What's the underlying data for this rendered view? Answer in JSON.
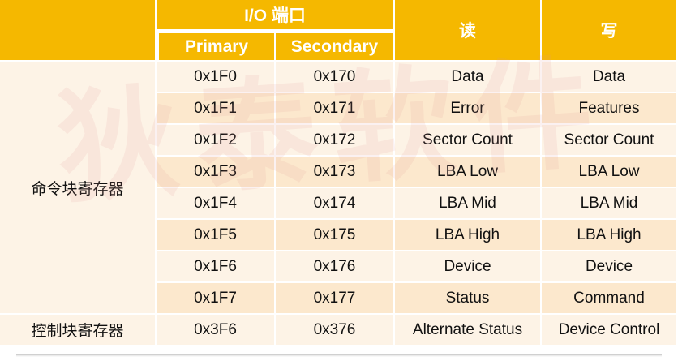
{
  "header": {
    "io_port": "I/O 端口",
    "primary": "Primary",
    "secondary": "Secondary",
    "read": "读",
    "write": "写"
  },
  "groups": {
    "command_block": "命令块寄存器",
    "control_block": "控制块寄存器"
  },
  "watermark": "狄泰软件",
  "rows": [
    {
      "primary": "0x1F0",
      "secondary": "0x170",
      "read": "Data",
      "write": "Data"
    },
    {
      "primary": "0x1F1",
      "secondary": "0x171",
      "read": "Error",
      "write": "Features"
    },
    {
      "primary": "0x1F2",
      "secondary": "0x172",
      "read": "Sector Count",
      "write": "Sector Count"
    },
    {
      "primary": "0x1F3",
      "secondary": "0x173",
      "read": "LBA Low",
      "write": "LBA Low"
    },
    {
      "primary": "0x1F4",
      "secondary": "0x174",
      "read": "LBA Mid",
      "write": "LBA Mid"
    },
    {
      "primary": "0x1F5",
      "secondary": "0x175",
      "read": "LBA High",
      "write": "LBA High"
    },
    {
      "primary": "0x1F6",
      "secondary": "0x176",
      "read": "Device",
      "write": "Device"
    },
    {
      "primary": "0x1F7",
      "secondary": "0x177",
      "read": "Status",
      "write": "Command"
    },
    {
      "primary": "0x3F6",
      "secondary": "0x376",
      "read": "Alternate Status",
      "write": "Device Control"
    }
  ],
  "colors": {
    "header_bg": "#f5b800",
    "row_light": "#fdf3e6",
    "row_dark": "#fce8cd"
  }
}
